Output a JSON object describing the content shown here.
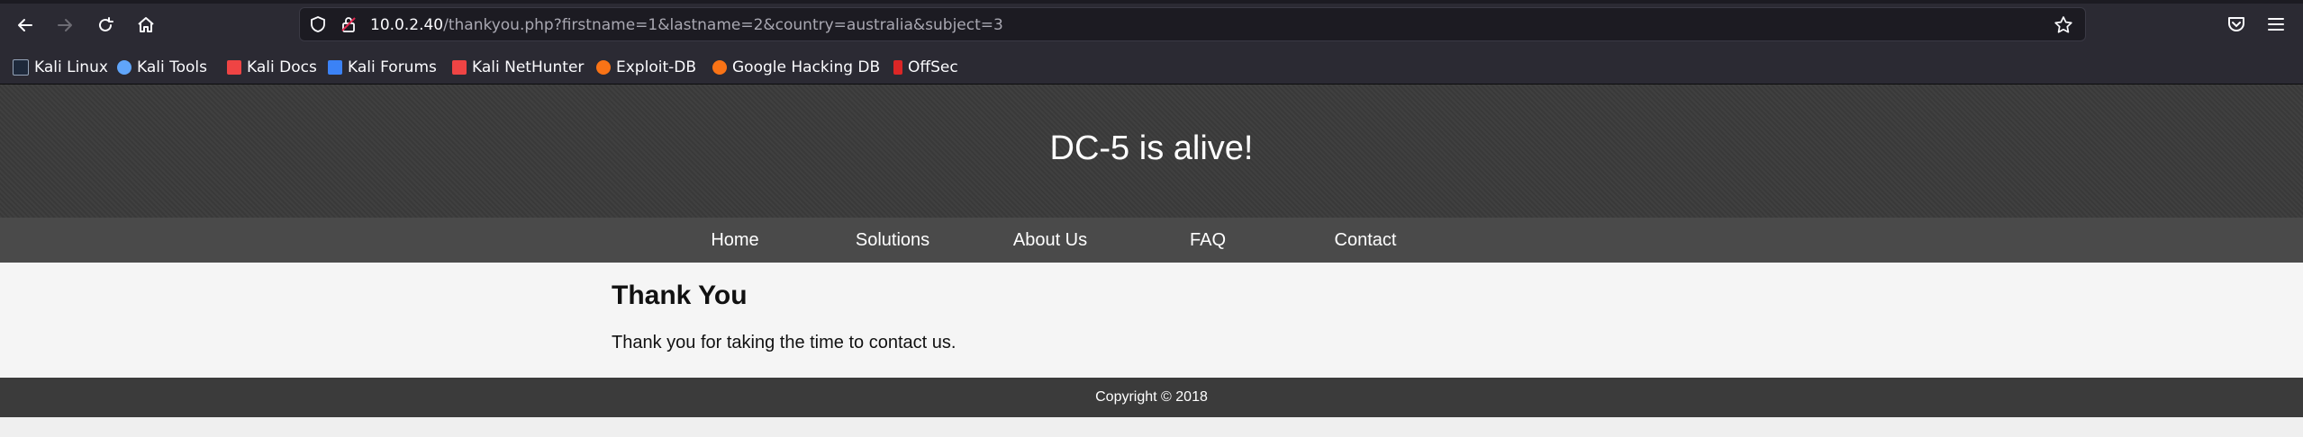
{
  "browser": {
    "url_host": "10.0.2.40",
    "url_path": "/thankyou.php?firstname=1&lastname=2&country=australia&subject=3",
    "bookmarks": [
      {
        "label": "Kali Linux",
        "color": "#3b82f6"
      },
      {
        "label": "Kali Tools",
        "color": "#60a5fa"
      },
      {
        "label": "Kali Docs",
        "color": "#ef4444"
      },
      {
        "label": "Kali Forums",
        "color": "#3b82f6"
      },
      {
        "label": "Kali NetHunter",
        "color": "#ef4444"
      },
      {
        "label": "Exploit-DB",
        "color": "#f97316"
      },
      {
        "label": "Google Hacking DB",
        "color": "#f97316"
      },
      {
        "label": "OffSec",
        "color": "#dc2626"
      }
    ]
  },
  "site": {
    "title": "DC-5 is alive!",
    "nav": [
      "Home",
      "Solutions",
      "About Us",
      "FAQ",
      "Contact"
    ],
    "heading": "Thank You",
    "message": "Thank you for taking the time to contact us.",
    "footer": "Copyright © 2018"
  }
}
